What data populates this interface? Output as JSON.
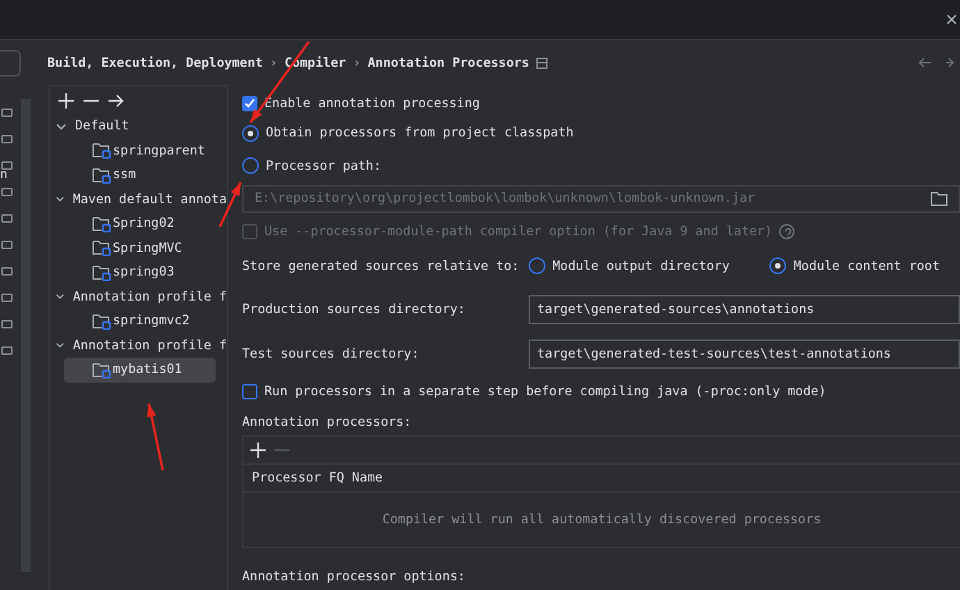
{
  "sidebar_fragment": {
    "text": "n"
  },
  "breadcrumb": [
    "Build, Execution, Deployment",
    "Compiler",
    "Annotation Processors"
  ],
  "breadcrumb_separators": [
    "›",
    "›"
  ],
  "tree": [
    {
      "label": "Default",
      "expanded": true,
      "children": [
        {
          "label": "springparent",
          "selected": false
        },
        {
          "label": "ssm",
          "selected": false
        }
      ]
    },
    {
      "label": "Maven default annota",
      "expanded": true,
      "children": [
        {
          "label": "Spring02",
          "selected": false
        },
        {
          "label": "SpringMVC",
          "selected": false
        },
        {
          "label": "spring03",
          "selected": false
        }
      ]
    },
    {
      "label": "Annotation profile f",
      "expanded": true,
      "children": [
        {
          "label": "springmvc2",
          "selected": false
        }
      ]
    },
    {
      "label": "Annotation profile f",
      "expanded": true,
      "children": [
        {
          "label": "mybatis01",
          "selected": true
        }
      ]
    }
  ],
  "enable_processing": {
    "label": "Enable annotation processing",
    "checked": true
  },
  "source_options": [
    {
      "label": "Obtain processors from project classpath",
      "selected": true
    },
    {
      "label": "Processor path:",
      "selected": false
    }
  ],
  "processor_path": {
    "value": "E:\\repository\\org\\projectlombok\\lombok\\unknown\\lombok-unknown.jar",
    "disabled": true
  },
  "module_path": {
    "label": "Use --processor-module-path compiler option (for Java 9 and later)",
    "checked": false,
    "disabled": true
  },
  "store_relative": {
    "label": "Store generated sources relative to:",
    "options": [
      {
        "label": "Module output directory",
        "selected": false
      },
      {
        "label": "Module content root",
        "selected": true
      }
    ]
  },
  "directories": [
    {
      "label": "Production sources directory:",
      "value": "target\\generated-sources\\annotations"
    },
    {
      "label": "Test sources directory:",
      "value": "target\\generated-test-sources\\test-annotations"
    }
  ],
  "separate_step": {
    "label": "Run processors in a separate step before compiling java (-proc:only mode)",
    "checked": false
  },
  "processors": {
    "title": "Annotation processors:",
    "column": "Processor FQ Name",
    "empty_text": "Compiler will run all automatically discovered processors"
  },
  "options_title": "Annotation processor options:"
}
